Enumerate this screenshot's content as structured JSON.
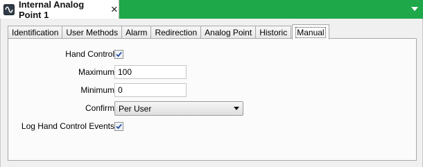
{
  "window": {
    "title": "Internal Analog Point 1",
    "close_glyph": "✕"
  },
  "tabs": [
    {
      "label": "Identification"
    },
    {
      "label": "User Methods"
    },
    {
      "label": "Alarm"
    },
    {
      "label": "Redirection"
    },
    {
      "label": "Analog Point"
    },
    {
      "label": "Historic"
    },
    {
      "label": "Manual",
      "active": true
    }
  ],
  "form": {
    "hand_control": {
      "label": "Hand Control",
      "checked": true
    },
    "maximum": {
      "label": "Maximum",
      "value": "100"
    },
    "minimum": {
      "label": "Minimum",
      "value": "0"
    },
    "confirm": {
      "label": "Confirm",
      "value": "Per User"
    },
    "log_events": {
      "label": "Log Hand Control Events",
      "checked": true
    }
  },
  "colors": {
    "titlebar": "#1fa84a",
    "check": "#2b4f9e"
  },
  "icons": {
    "doc": "analog-wave-icon",
    "overflow": "chevron-down-icon",
    "combo": "dropdown-arrow-icon"
  }
}
